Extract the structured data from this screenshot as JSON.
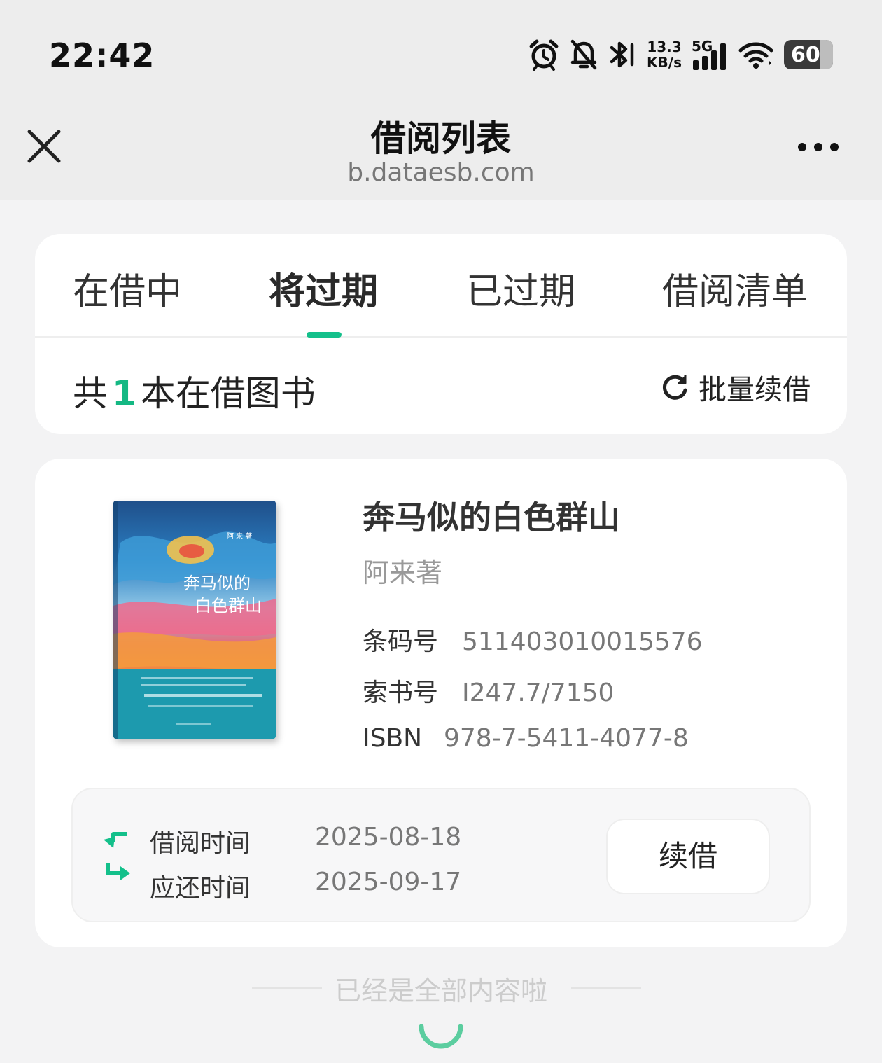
{
  "status_bar": {
    "time": "22:42",
    "net_speed_value": "13.3",
    "net_speed_unit": "KB/s",
    "network": "5G",
    "battery": "60",
    "icons": [
      "alarm-icon",
      "bell-off-icon",
      "bluetooth-icon",
      "signal-icon",
      "wifi-icon",
      "battery-icon"
    ]
  },
  "header": {
    "title": "借阅列表",
    "url": "b.dataesb.com"
  },
  "tabs": [
    {
      "label": "在借中",
      "active": false
    },
    {
      "label": "将过期",
      "active": true
    },
    {
      "label": "已过期",
      "active": false
    },
    {
      "label": "借阅清单",
      "active": false
    }
  ],
  "summary": {
    "prefix": "共",
    "count": "1",
    "suffix": "本在借图书",
    "batch_renew_label": "批量续借"
  },
  "book": {
    "title": "奔马似的白色群山",
    "author": "阿来著",
    "barcode_label": "条码号",
    "barcode": "511403010015576",
    "call_number_label": "索书号",
    "call_number": "I247.7/7150",
    "isbn_label": "ISBN",
    "isbn": "978-7-5411-4077-8",
    "cover_title_line1": "奔马似的",
    "cover_title_line2": "白色群山",
    "cover_author": "阿 来 著"
  },
  "loan": {
    "borrow_label": "借阅时间",
    "borrow_date": "2025-08-18",
    "due_label": "应还时间",
    "due_date": "2025-09-17",
    "renew_label": "续借"
  },
  "footer": {
    "end_text": "已经是全部内容啦"
  },
  "colors": {
    "accent": "#14c08b",
    "background": "#f3f3f4",
    "card": "#ffffff"
  }
}
